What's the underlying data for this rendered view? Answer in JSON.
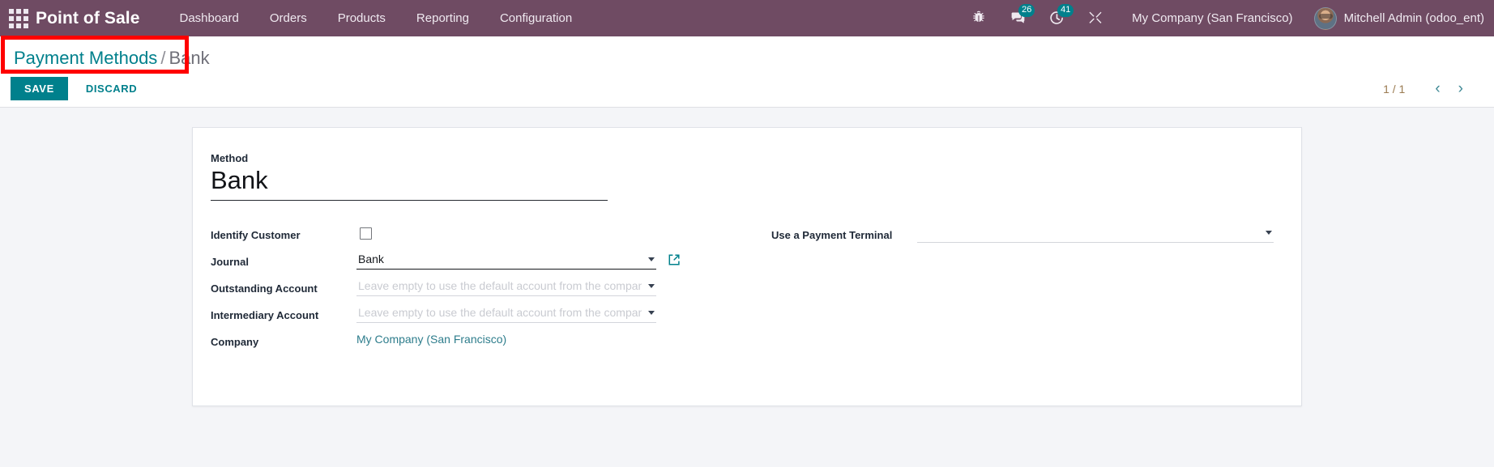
{
  "navbar": {
    "apps_icon": "apps-grid-icon",
    "brand": "Point of Sale",
    "menu": [
      {
        "label": "Dashboard"
      },
      {
        "label": "Orders"
      },
      {
        "label": "Products"
      },
      {
        "label": "Reporting"
      },
      {
        "label": "Configuration"
      }
    ],
    "icons": [
      {
        "name": "bug-icon",
        "badge": null
      },
      {
        "name": "messages-icon",
        "badge": "26"
      },
      {
        "name": "activities-clock-icon",
        "badge": "41"
      },
      {
        "name": "developer-tools-icon",
        "badge": null
      }
    ],
    "company": "My Company (San Francisco)",
    "user": "Mitchell Admin (odoo_ent)",
    "avatar_name": "user-avatar"
  },
  "control_panel": {
    "breadcrumb": {
      "parent": "Payment Methods",
      "separator": "/",
      "current": "Bank"
    },
    "save_label": "SAVE",
    "discard_label": "DISCARD",
    "pager": {
      "count": "1 / 1",
      "prev": "‹",
      "next": "›"
    }
  },
  "form": {
    "title_caption": "Method",
    "title_value": "Bank",
    "left_fields": [
      {
        "label": "Identify Customer",
        "type": "checkbox",
        "checked": false
      },
      {
        "label": "Journal",
        "type": "select",
        "value": "Bank",
        "placeholder": "",
        "has_external_link": true
      },
      {
        "label": "Outstanding Account",
        "type": "select",
        "value": "",
        "placeholder": "Leave empty to use the default account from the company setting",
        "has_external_link": false
      },
      {
        "label": "Intermediary Account",
        "type": "select",
        "value": "",
        "placeholder": "Leave empty to use the default account from the company setting",
        "has_external_link": false
      },
      {
        "label": "Company",
        "type": "link",
        "value": "My Company (San Francisco)"
      }
    ],
    "right_fields": [
      {
        "label": "Use a Payment Terminal",
        "type": "select",
        "value": "",
        "placeholder": ""
      }
    ]
  },
  "colors": {
    "navbar_bg": "#6F4B63",
    "accent_teal": "#00808C",
    "highlight_box": "#FF0000",
    "badge_bg": "#00808C",
    "content_bg": "#F4F5F8",
    "pager_text": "#9B7B52"
  }
}
